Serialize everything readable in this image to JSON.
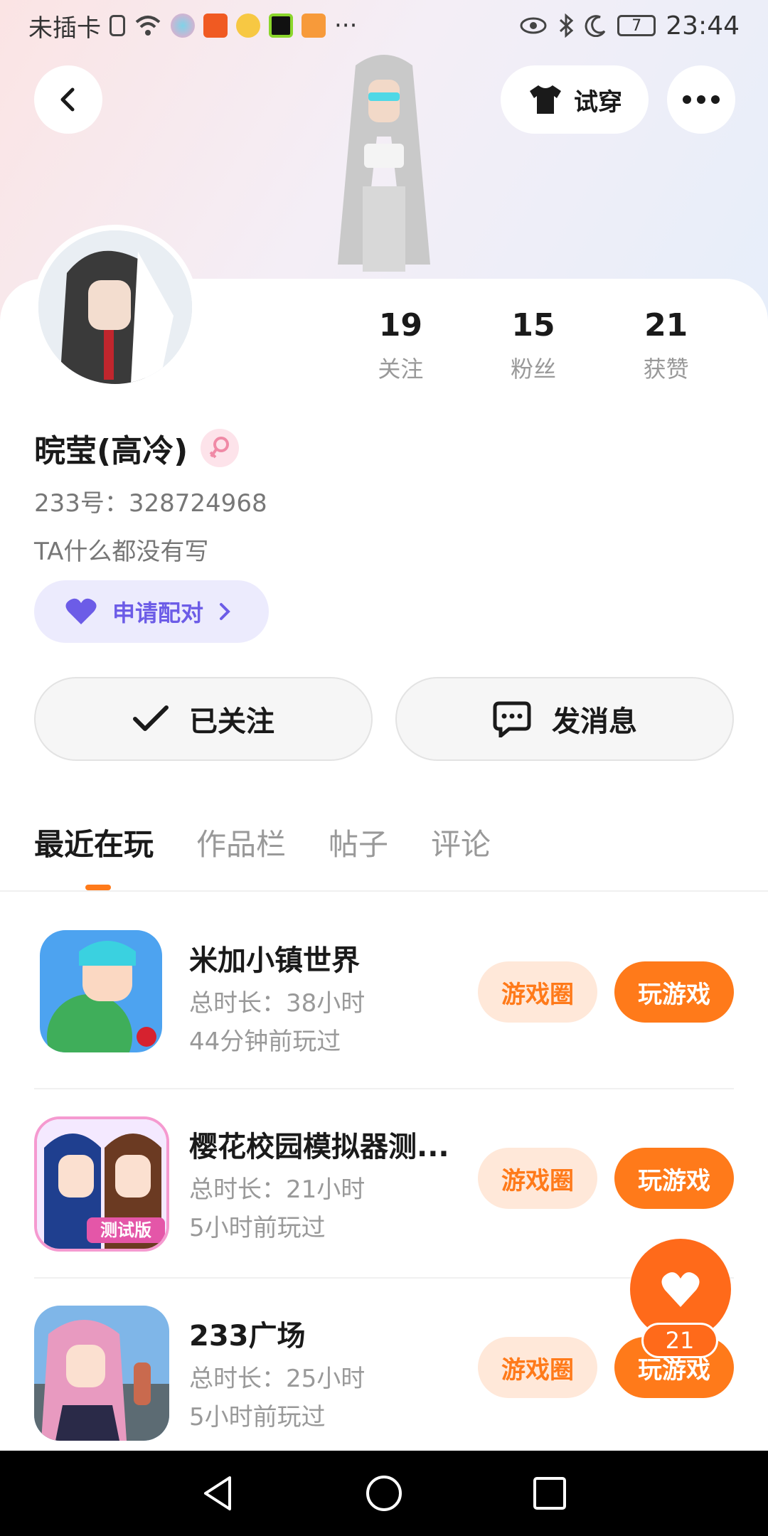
{
  "status_bar": {
    "carrier": "未插卡",
    "battery": "7",
    "time": "23:44",
    "more": "···"
  },
  "header": {
    "tryon_label": "试穿"
  },
  "profile": {
    "stats": [
      {
        "num": "19",
        "label": "关注"
      },
      {
        "num": "15",
        "label": "粉丝"
      },
      {
        "num": "21",
        "label": "获赞"
      }
    ],
    "name": "晥莹(高冷)",
    "uid": "233号：328724968",
    "bio": "TA什么都没有写",
    "pair_label": "申请配对"
  },
  "actions": {
    "follow_label": "已关注",
    "message_label": "发消息"
  },
  "tabs": [
    "最近在玩",
    "作品栏",
    "帖子",
    "评论"
  ],
  "games": [
    {
      "title": "米加小镇世界",
      "duration": "总时长：38小时",
      "last_played": "44分钟前玩过",
      "circle_label": "游戏圈",
      "play_label": "玩游戏"
    },
    {
      "title": "樱花校园模拟器测...",
      "duration": "总时长：21小时",
      "last_played": "5小时前玩过",
      "circle_label": "游戏圈",
      "play_label": "玩游戏",
      "badge": "测试版"
    },
    {
      "title": "233广场",
      "duration": "总时长：25小时",
      "last_played": "5小时前玩过",
      "circle_label": "游戏圈",
      "play_label": "玩游戏"
    }
  ],
  "like": {
    "count": "21"
  },
  "colors": {
    "accent": "#ff7a1a",
    "pair": "#6c5ce7",
    "pair_bg": "#ecebfd"
  }
}
